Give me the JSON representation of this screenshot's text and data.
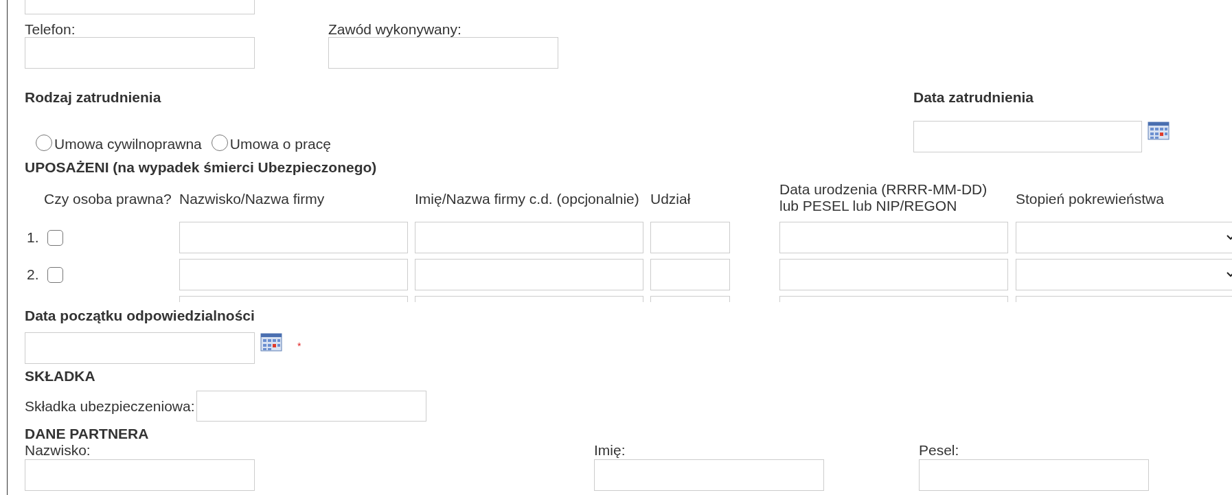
{
  "contact_fields": [
    {
      "label": "Telefon:"
    },
    {
      "label": "Zawód wykonywany:"
    }
  ],
  "employment": {
    "heading": "Rodzaj zatrudnienia",
    "options": [
      {
        "label": "Umowa cywilnoprawna",
        "selected": false
      },
      {
        "label": "Umowa o pracę",
        "selected": false
      }
    ]
  },
  "employment_date": {
    "label": "Data zatrudnienia"
  },
  "beneficiaries": {
    "heading": "UPOSAŻENI (na wypadek śmierci Ubezpieczonego)",
    "columns": [
      "Czy osoba prawna?",
      "Nazwisko/Nazwa firmy",
      "Imię/Nazwa firmy c.d. (opcjonalnie)",
      "Udział",
      "Data urodzenia (RRRR-MM-DD)\nlub PESEL lub NIP/REGON",
      "Stopień pokrewieństwa"
    ],
    "rows": [
      {
        "kind": "full",
        "number": "1.",
        "legal_entity": false
      },
      {
        "kind": "full",
        "number": "2.",
        "legal_entity": false
      },
      {
        "kind": "clipped"
      }
    ]
  },
  "liability_start": {
    "label": "Data początku odpowiedzialności",
    "required_mark": "*"
  },
  "premium": {
    "heading": "SKŁADKA",
    "label": "Składka ubezpieczeniowa:"
  },
  "partner": {
    "heading": "DANE PARTNERA",
    "fields": [
      {
        "label": "Nazwisko:"
      },
      {
        "label": "Imię:"
      },
      {
        "label": "Pesel:"
      }
    ]
  }
}
